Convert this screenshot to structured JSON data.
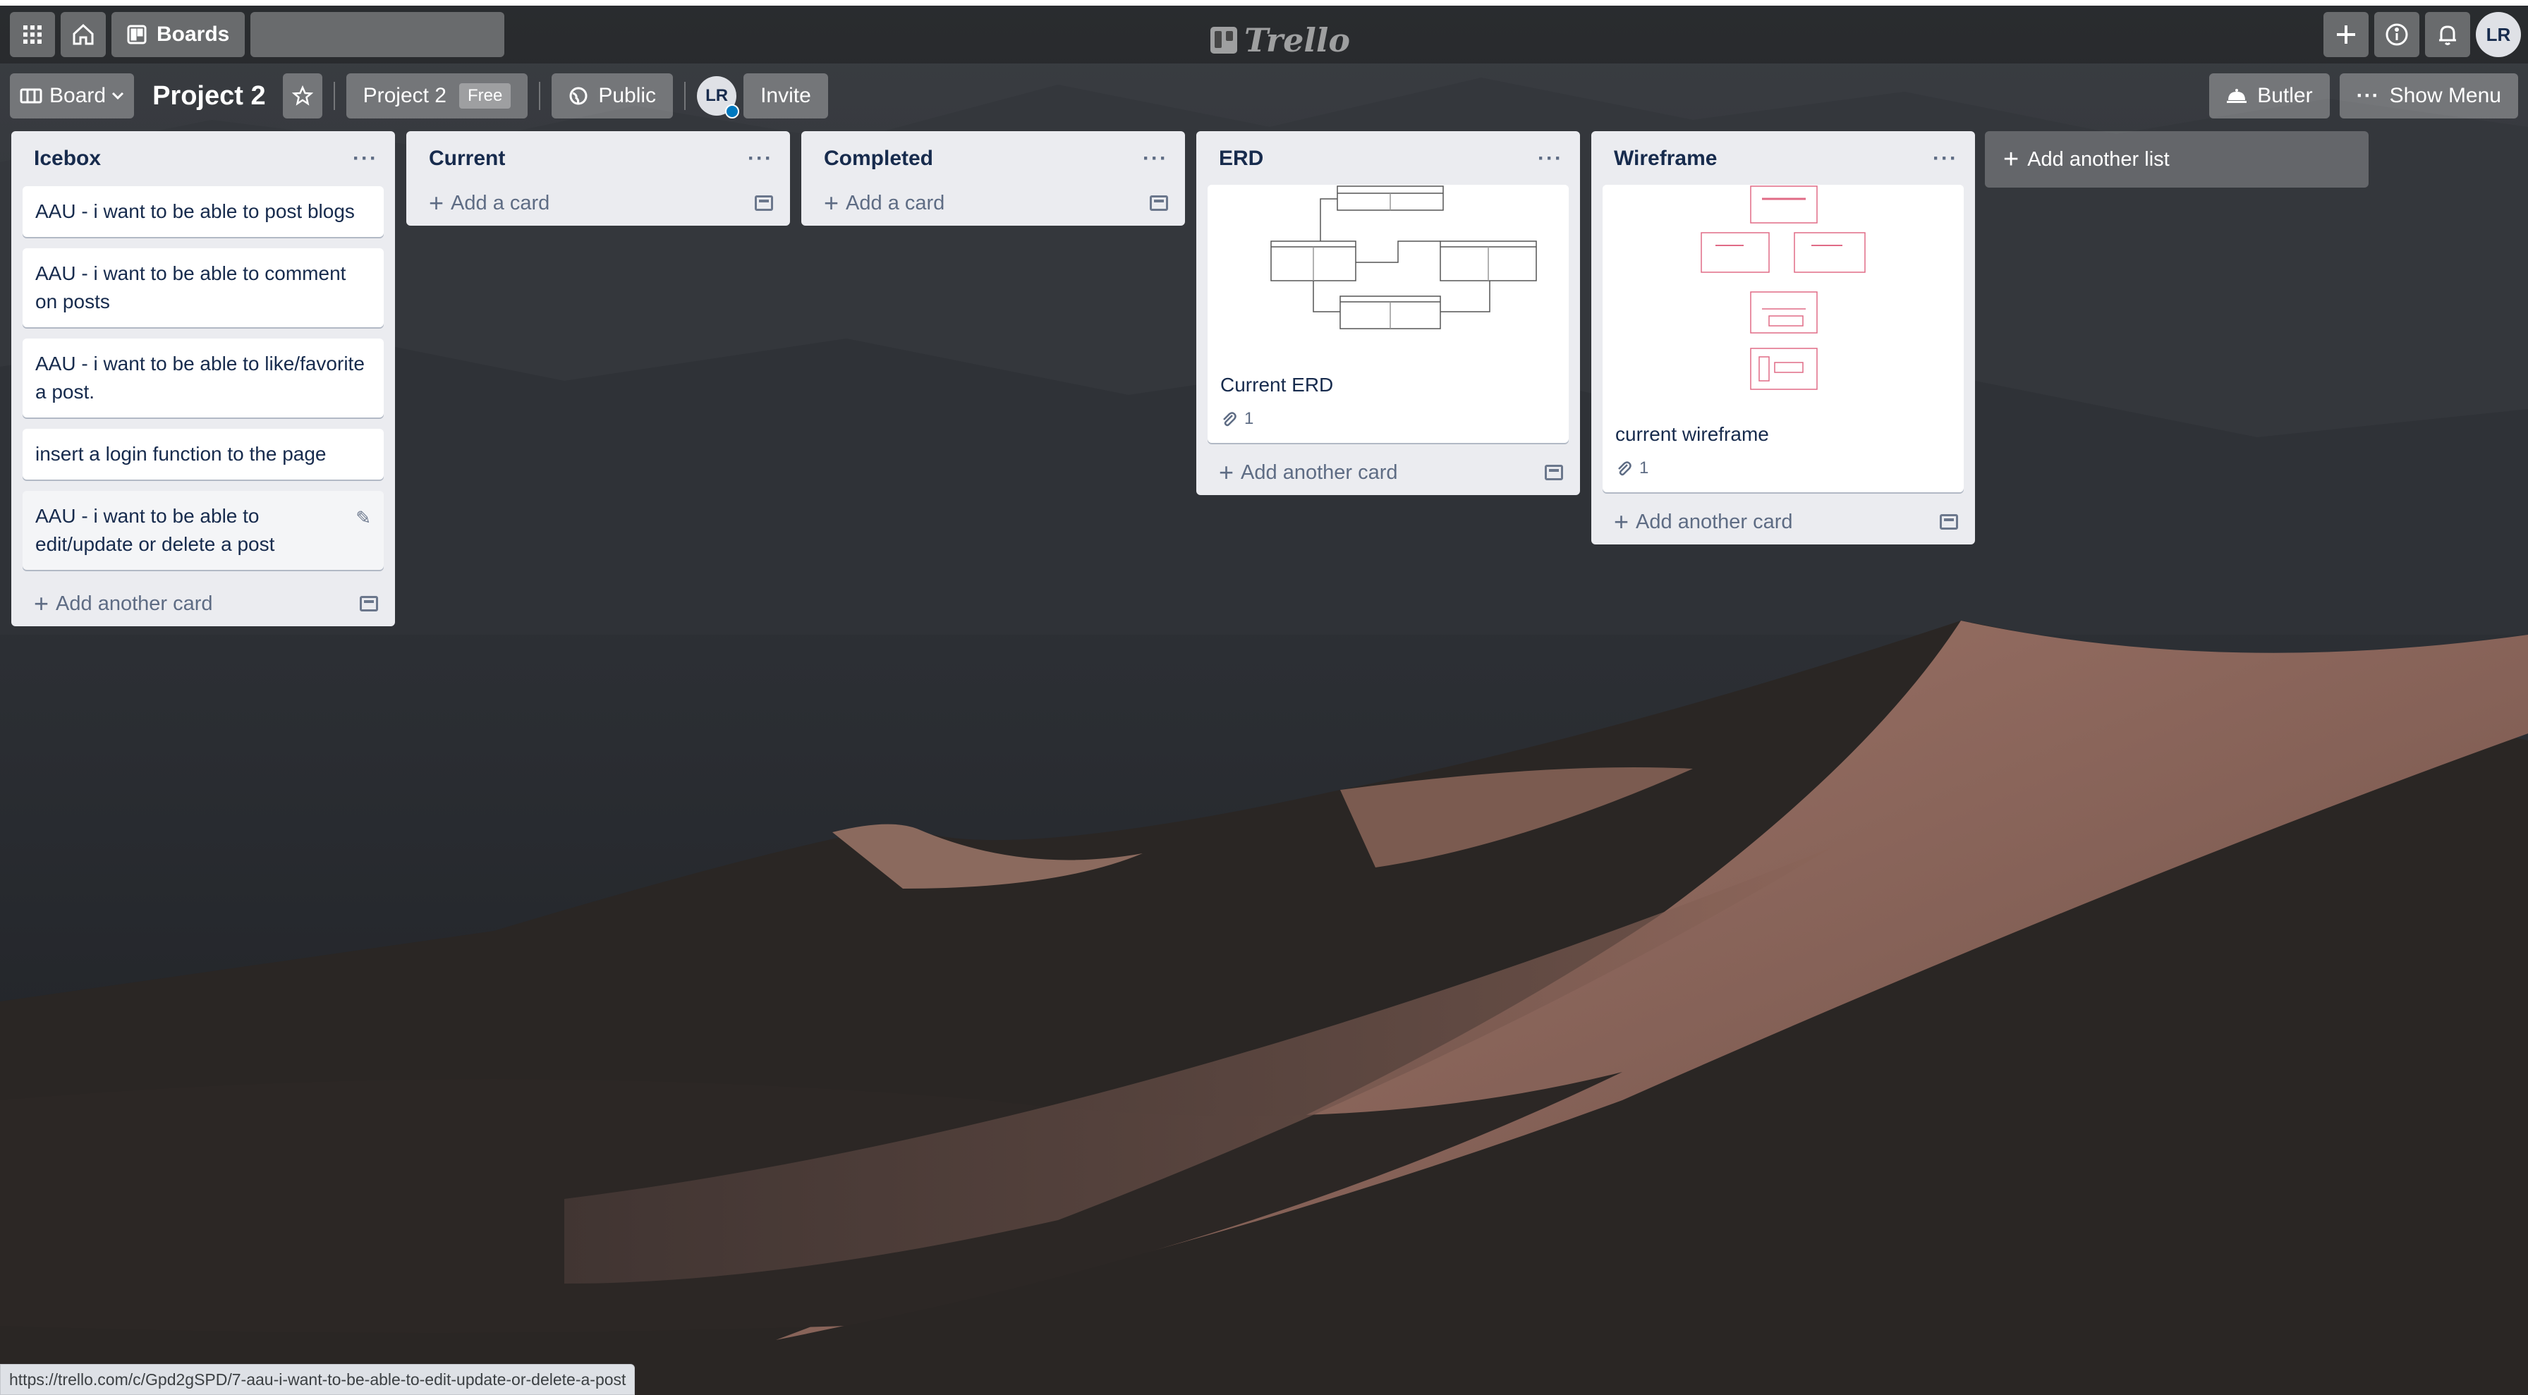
{
  "header": {
    "boards_label": "Boards",
    "search_placeholder": "",
    "logo_text": "Trello",
    "avatar_initials": "LR"
  },
  "boardbar": {
    "view_label": "Board",
    "title": "Project 2",
    "workspace_label": "Project 2",
    "workspace_badge": "Free",
    "visibility_label": "Public",
    "member_initials": "LR",
    "invite_label": "Invite",
    "butler_label": "Butler",
    "menu_label": "Show Menu"
  },
  "lists": [
    {
      "title": "Icebox",
      "cards": [
        "AAU - i want to be able to post blogs",
        "AAU - i want to be able to comment on posts",
        "AAU - i want to be able to like/favorite a post.",
        "insert a login function to the page",
        "AAU - i want to be able to edit/update or delete a post"
      ],
      "add_label": "Add another card"
    },
    {
      "title": "Current",
      "cards": [],
      "add_label": "Add a card"
    },
    {
      "title": "Completed",
      "cards": [],
      "add_label": "Add a card"
    },
    {
      "title": "ERD",
      "cards": [
        {
          "title": "Current ERD",
          "attachments": "1"
        }
      ],
      "add_label": "Add another card"
    },
    {
      "title": "Wireframe",
      "cards": [
        {
          "title": "current wireframe",
          "attachments": "1"
        }
      ],
      "add_label": "Add another card"
    }
  ],
  "add_list_label": "Add another list",
  "status_url": "https://trello.com/c/Gpd2gSPD/7-aau-i-want-to-be-able-to-edit-update-or-delete-a-post",
  "colors": {
    "list_bg": "#ebecf0",
    "card_text": "#172b4d",
    "muted_text": "#5e6c84"
  }
}
